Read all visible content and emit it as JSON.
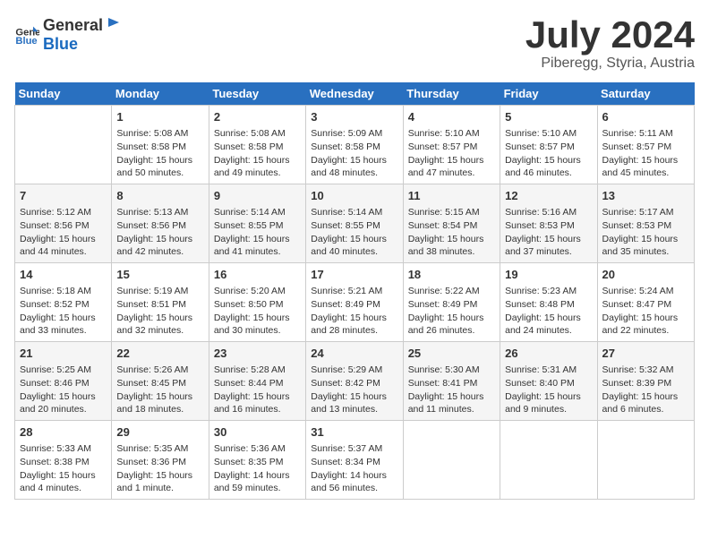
{
  "header": {
    "logo_general": "General",
    "logo_blue": "Blue",
    "month": "July 2024",
    "location": "Piberegg, Styria, Austria"
  },
  "days_of_week": [
    "Sunday",
    "Monday",
    "Tuesday",
    "Wednesday",
    "Thursday",
    "Friday",
    "Saturday"
  ],
  "weeks": [
    [
      {
        "day": "",
        "content": ""
      },
      {
        "day": "1",
        "content": "Sunrise: 5:08 AM\nSunset: 8:58 PM\nDaylight: 15 hours\nand 50 minutes."
      },
      {
        "day": "2",
        "content": "Sunrise: 5:08 AM\nSunset: 8:58 PM\nDaylight: 15 hours\nand 49 minutes."
      },
      {
        "day": "3",
        "content": "Sunrise: 5:09 AM\nSunset: 8:58 PM\nDaylight: 15 hours\nand 48 minutes."
      },
      {
        "day": "4",
        "content": "Sunrise: 5:10 AM\nSunset: 8:57 PM\nDaylight: 15 hours\nand 47 minutes."
      },
      {
        "day": "5",
        "content": "Sunrise: 5:10 AM\nSunset: 8:57 PM\nDaylight: 15 hours\nand 46 minutes."
      },
      {
        "day": "6",
        "content": "Sunrise: 5:11 AM\nSunset: 8:57 PM\nDaylight: 15 hours\nand 45 minutes."
      }
    ],
    [
      {
        "day": "7",
        "content": "Sunrise: 5:12 AM\nSunset: 8:56 PM\nDaylight: 15 hours\nand 44 minutes."
      },
      {
        "day": "8",
        "content": "Sunrise: 5:13 AM\nSunset: 8:56 PM\nDaylight: 15 hours\nand 42 minutes."
      },
      {
        "day": "9",
        "content": "Sunrise: 5:14 AM\nSunset: 8:55 PM\nDaylight: 15 hours\nand 41 minutes."
      },
      {
        "day": "10",
        "content": "Sunrise: 5:14 AM\nSunset: 8:55 PM\nDaylight: 15 hours\nand 40 minutes."
      },
      {
        "day": "11",
        "content": "Sunrise: 5:15 AM\nSunset: 8:54 PM\nDaylight: 15 hours\nand 38 minutes."
      },
      {
        "day": "12",
        "content": "Sunrise: 5:16 AM\nSunset: 8:53 PM\nDaylight: 15 hours\nand 37 minutes."
      },
      {
        "day": "13",
        "content": "Sunrise: 5:17 AM\nSunset: 8:53 PM\nDaylight: 15 hours\nand 35 minutes."
      }
    ],
    [
      {
        "day": "14",
        "content": "Sunrise: 5:18 AM\nSunset: 8:52 PM\nDaylight: 15 hours\nand 33 minutes."
      },
      {
        "day": "15",
        "content": "Sunrise: 5:19 AM\nSunset: 8:51 PM\nDaylight: 15 hours\nand 32 minutes."
      },
      {
        "day": "16",
        "content": "Sunrise: 5:20 AM\nSunset: 8:50 PM\nDaylight: 15 hours\nand 30 minutes."
      },
      {
        "day": "17",
        "content": "Sunrise: 5:21 AM\nSunset: 8:49 PM\nDaylight: 15 hours\nand 28 minutes."
      },
      {
        "day": "18",
        "content": "Sunrise: 5:22 AM\nSunset: 8:49 PM\nDaylight: 15 hours\nand 26 minutes."
      },
      {
        "day": "19",
        "content": "Sunrise: 5:23 AM\nSunset: 8:48 PM\nDaylight: 15 hours\nand 24 minutes."
      },
      {
        "day": "20",
        "content": "Sunrise: 5:24 AM\nSunset: 8:47 PM\nDaylight: 15 hours\nand 22 minutes."
      }
    ],
    [
      {
        "day": "21",
        "content": "Sunrise: 5:25 AM\nSunset: 8:46 PM\nDaylight: 15 hours\nand 20 minutes."
      },
      {
        "day": "22",
        "content": "Sunrise: 5:26 AM\nSunset: 8:45 PM\nDaylight: 15 hours\nand 18 minutes."
      },
      {
        "day": "23",
        "content": "Sunrise: 5:28 AM\nSunset: 8:44 PM\nDaylight: 15 hours\nand 16 minutes."
      },
      {
        "day": "24",
        "content": "Sunrise: 5:29 AM\nSunset: 8:42 PM\nDaylight: 15 hours\nand 13 minutes."
      },
      {
        "day": "25",
        "content": "Sunrise: 5:30 AM\nSunset: 8:41 PM\nDaylight: 15 hours\nand 11 minutes."
      },
      {
        "day": "26",
        "content": "Sunrise: 5:31 AM\nSunset: 8:40 PM\nDaylight: 15 hours\nand 9 minutes."
      },
      {
        "day": "27",
        "content": "Sunrise: 5:32 AM\nSunset: 8:39 PM\nDaylight: 15 hours\nand 6 minutes."
      }
    ],
    [
      {
        "day": "28",
        "content": "Sunrise: 5:33 AM\nSunset: 8:38 PM\nDaylight: 15 hours\nand 4 minutes."
      },
      {
        "day": "29",
        "content": "Sunrise: 5:35 AM\nSunset: 8:36 PM\nDaylight: 15 hours\nand 1 minute."
      },
      {
        "day": "30",
        "content": "Sunrise: 5:36 AM\nSunset: 8:35 PM\nDaylight: 14 hours\nand 59 minutes."
      },
      {
        "day": "31",
        "content": "Sunrise: 5:37 AM\nSunset: 8:34 PM\nDaylight: 14 hours\nand 56 minutes."
      },
      {
        "day": "",
        "content": ""
      },
      {
        "day": "",
        "content": ""
      },
      {
        "day": "",
        "content": ""
      }
    ]
  ]
}
